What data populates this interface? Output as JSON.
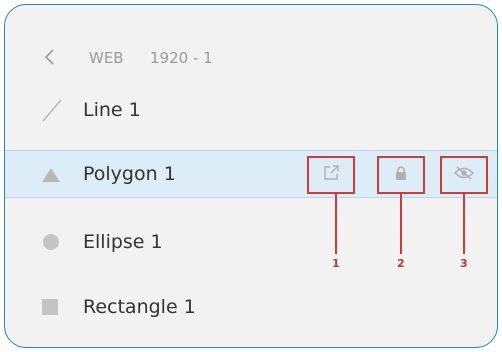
{
  "breadcrumb": {
    "back_icon": "chevron-left-icon",
    "section": "WEB",
    "frame": "1920 - 1"
  },
  "layers": [
    {
      "label": "Line 1",
      "icon": "line-icon"
    },
    {
      "label": "Polygon 1",
      "icon": "triangle-icon",
      "selected": true
    },
    {
      "label": "Ellipse 1",
      "icon": "circle-icon"
    },
    {
      "label": "Rectangle 1",
      "icon": "square-icon"
    }
  ],
  "actions": [
    {
      "icon": "open-external-icon",
      "callout": "1"
    },
    {
      "icon": "lock-icon",
      "callout": "2"
    },
    {
      "icon": "eye-hidden-icon",
      "callout": "3"
    }
  ],
  "colors": {
    "frame_border": "#1f8ea3",
    "selected_row": "#dcedf8",
    "callout": "#d23a3a",
    "muted_icon": "#b8b8b8"
  }
}
